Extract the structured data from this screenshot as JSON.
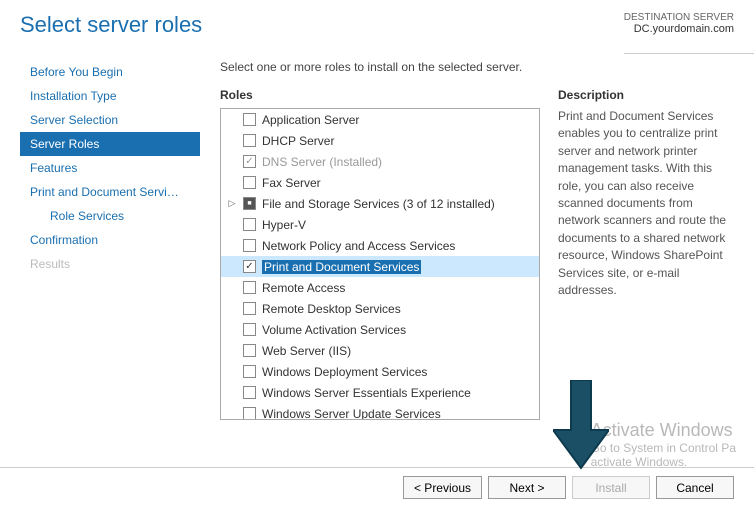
{
  "header": {
    "title": "Select server roles",
    "dest_label": "DESTINATION SERVER",
    "dest_server": "DC.yourdomain.com"
  },
  "nav": [
    {
      "label": "Before You Begin",
      "state": "normal"
    },
    {
      "label": "Installation Type",
      "state": "normal"
    },
    {
      "label": "Server Selection",
      "state": "normal"
    },
    {
      "label": "Server Roles",
      "state": "active"
    },
    {
      "label": "Features",
      "state": "normal"
    },
    {
      "label": "Print and Document Servi…",
      "state": "normal"
    },
    {
      "label": "Role Services",
      "state": "normal",
      "sub": true
    },
    {
      "label": "Confirmation",
      "state": "normal"
    },
    {
      "label": "Results",
      "state": "disabled"
    }
  ],
  "prompt": "Select one or more roles to install on the selected server.",
  "roles_heading": "Roles",
  "desc_heading": "Description",
  "roles": [
    {
      "label": "Application Server",
      "checked": false
    },
    {
      "label": "DHCP Server",
      "checked": false
    },
    {
      "label": "DNS Server (Installed)",
      "checked": true,
      "disabled": true
    },
    {
      "label": "Fax Server",
      "checked": false
    },
    {
      "label": "File and Storage Services (3 of 12 installed)",
      "partial": true,
      "expandable": true
    },
    {
      "label": "Hyper-V",
      "checked": false
    },
    {
      "label": "Network Policy and Access Services",
      "checked": false
    },
    {
      "label": "Print and Document Services",
      "checked": true,
      "selected": true
    },
    {
      "label": "Remote Access",
      "checked": false
    },
    {
      "label": "Remote Desktop Services",
      "checked": false
    },
    {
      "label": "Volume Activation Services",
      "checked": false
    },
    {
      "label": "Web Server (IIS)",
      "checked": false
    },
    {
      "label": "Windows Deployment Services",
      "checked": false
    },
    {
      "label": "Windows Server Essentials Experience",
      "checked": false
    },
    {
      "label": "Windows Server Update Services",
      "checked": false
    }
  ],
  "description": "Print and Document Services enables you to centralize print server and network printer management tasks. With this role, you can also receive scanned documents from network scanners and route the documents to a shared network resource, Windows SharePoint Services site, or e-mail addresses.",
  "footer": {
    "previous": "< Previous",
    "next": "Next >",
    "install": "Install",
    "cancel": "Cancel"
  },
  "watermark": {
    "line1": "Activate Windows",
    "line2": "Go to System in Control Pa",
    "line3": "activate Windows."
  }
}
